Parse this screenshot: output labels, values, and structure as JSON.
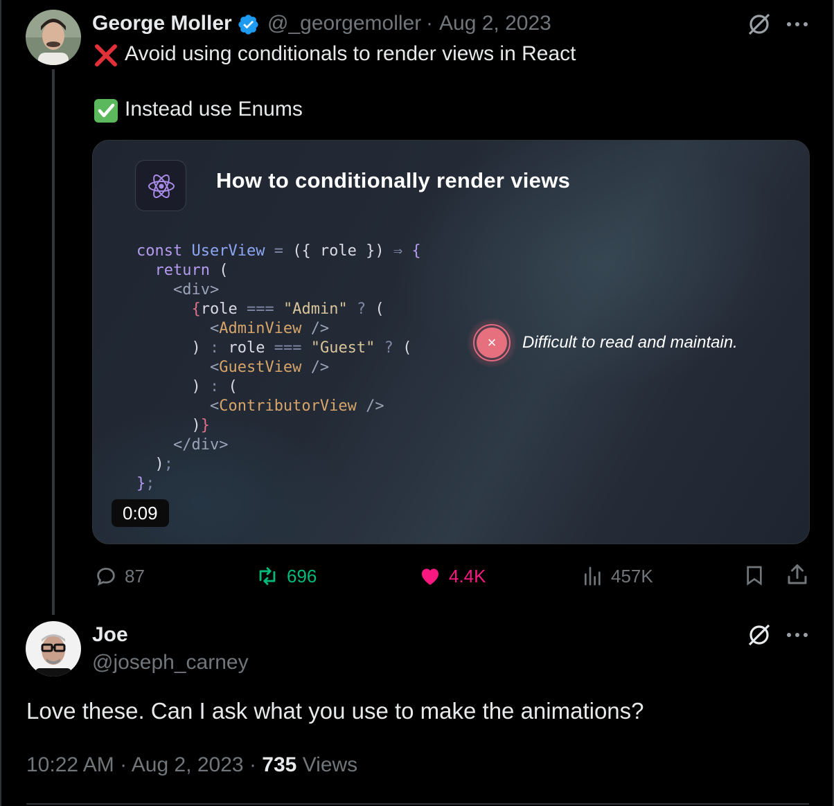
{
  "tweet": {
    "author_name": "George Moller",
    "handle": "@_georgemoller",
    "separator": "·",
    "date": "Aug 2, 2023",
    "line1": "Avoid using conditionals to render views in React",
    "line2": "Instead use Enums",
    "media": {
      "title": "How to conditionally render views",
      "note": "Difficult to read and maintain.",
      "duration": "0:09",
      "close_glyph": "×"
    },
    "stats": {
      "replies": "87",
      "retweets": "696",
      "likes": "4.4K",
      "views": "457K"
    },
    "accent_colors": {
      "retweet": "#00ba7c",
      "like": "#f91880",
      "verified": "#1d9bf0"
    }
  },
  "reply": {
    "author_name": "Joe",
    "handle": "@joseph_carney",
    "text": "Love these. Can I ask what you use to make the animations?",
    "time": "10:22 AM",
    "date": "Aug 2, 2023",
    "separator": "·",
    "views_count": "735",
    "views_label": "Views"
  },
  "icons": [
    "verified-badge-icon",
    "cross-mark-emoji",
    "check-mark-emoji",
    "react-atom-icon",
    "reply-icon",
    "retweet-icon",
    "heart-icon",
    "analytics-icon",
    "bookmark-icon",
    "share-icon",
    "grok-icon",
    "more-icon"
  ]
}
